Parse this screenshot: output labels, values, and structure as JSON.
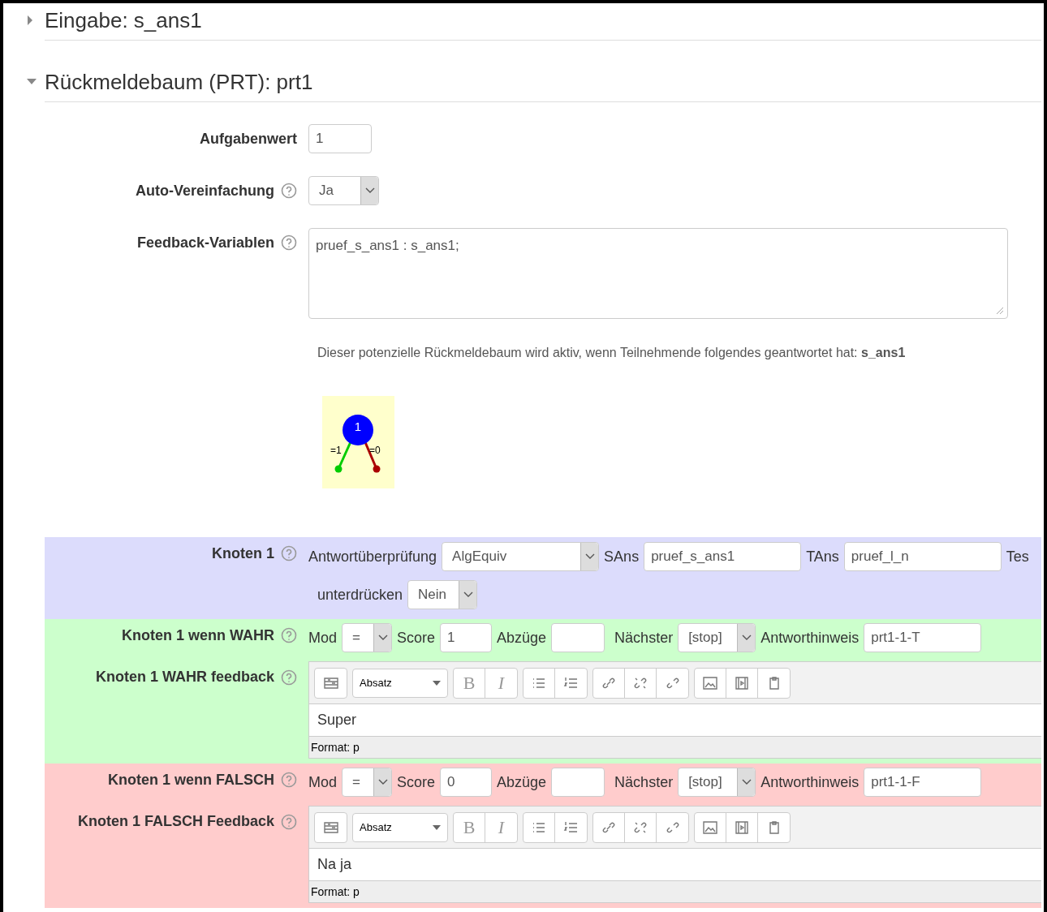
{
  "sections": [
    {
      "title": "Eingabe: s_ans1",
      "expanded": false
    },
    {
      "title": "Rückmeldebaum (PRT): prt1",
      "expanded": true
    }
  ],
  "fields": [
    {
      "label": "Aufgabenwert",
      "help": false,
      "kind": "text",
      "value": "1"
    },
    {
      "label": "Auto-Vereinfachung",
      "help": true,
      "kind": "select",
      "value": "Ja"
    },
    {
      "label": "Feedback-Variablen",
      "help": true,
      "kind": "textarea",
      "value": "pruef_s_ans1 : s_ans1;"
    }
  ],
  "notice": "Dieser potenzielle Rückmeldebaum wird aktiv, wenn Teilnehmende folgendes geantwortet hat: **s_ans1**",
  "graph": {
    "node": "1",
    "true_label": "=1",
    "false_label": "=0"
  },
  "node": {
    "label": "Knoten 1",
    "test_label": "Antwortüberprüfung",
    "test": "AlgEquiv",
    "sans_label": "SAns",
    "sans": "pruef_s_ans1",
    "tans_label": "TAns",
    "tans": "pruef_l_n",
    "cut_label": "Tes",
    "quiet_label": "unterdrücken",
    "quiet": "Nein"
  },
  "branches": [
    {
      "label": "Knoten 1 wenn WAHR",
      "color": "#ccffcc",
      "mod_label": "Mod",
      "mod": "=",
      "score_label": "Score",
      "score": "1",
      "penalty_label": "Abzüge",
      "next_label": "Nächster",
      "next": "[stop]",
      "note_label": "Antworthinweis",
      "note": "prt1-1-T",
      "feedback_label": "Knoten 1 WAHR feedback",
      "style": "Absatz",
      "bold_key": "B",
      "italic_key": "I",
      "feedback": "Super",
      "status": "Format: p"
    },
    {
      "label": "Knoten 1 wenn FALSCH",
      "color": "#ffcccc",
      "mod_label": "Mod",
      "mod": "=",
      "score_label": "Score",
      "score": "0",
      "penalty_label": "Abzüge",
      "next_label": "Nächster",
      "next": "[stop]",
      "note_label": "Antworthinweis",
      "note": "prt1-1-F",
      "feedback_label": "Knoten 1 FALSCH Feedback",
      "style": "Absatz",
      "bold_key": "B",
      "italic_key": "I",
      "feedback": "Na ja",
      "status": "Format: p"
    }
  ]
}
